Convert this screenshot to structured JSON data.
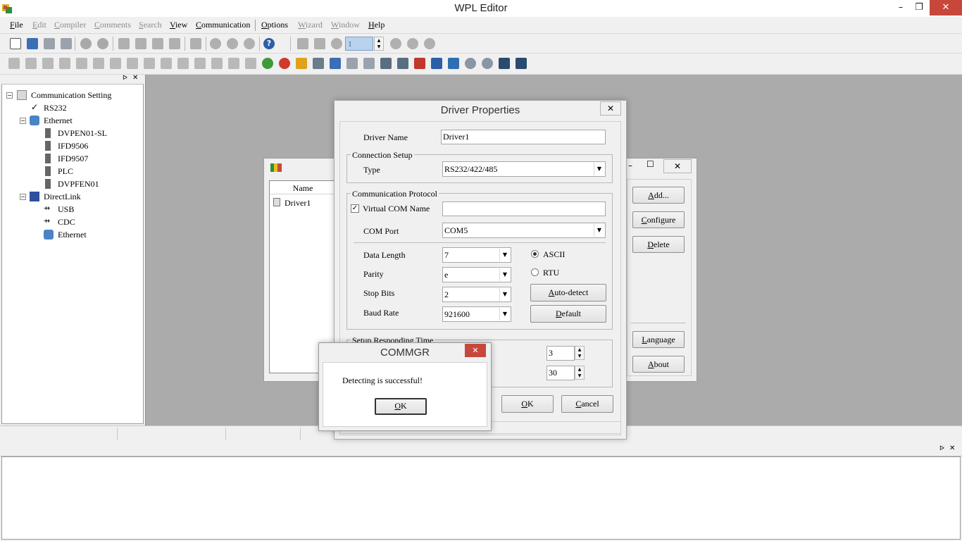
{
  "app": {
    "title": "WPL Editor"
  },
  "window_controls": {
    "minimize": "–",
    "restore": "❐",
    "close": "✕"
  },
  "menu": [
    {
      "label": "File",
      "enabled": true
    },
    {
      "label": "Edit",
      "enabled": false
    },
    {
      "label": "Compiler",
      "enabled": false
    },
    {
      "label": "Comments",
      "enabled": false
    },
    {
      "label": "Search",
      "enabled": false
    },
    {
      "label": "View",
      "enabled": true
    },
    {
      "label": "Communication",
      "enabled": true
    },
    {
      "label": "Options",
      "enabled": true
    },
    {
      "label": "Wizard",
      "enabled": false
    },
    {
      "label": "Window",
      "enabled": false
    },
    {
      "label": "Help",
      "enabled": true
    }
  ],
  "toolbar": {
    "station_value": "1",
    "help_icon": "?"
  },
  "tree": {
    "root": "Communication Setting",
    "rs232": "RS232",
    "ethernet": "Ethernet",
    "eth_items": [
      "DVPEN01-SL",
      "IFD9506",
      "IFD9507",
      "PLC",
      "DVPFEN01"
    ],
    "directlink": "DirectLink",
    "dl_items": [
      "USB",
      "CDC",
      "Ethernet"
    ],
    "check_mark": "✓"
  },
  "main_dialog": {
    "list_header": "Name",
    "drivers": [
      "Driver1"
    ],
    "buttons": {
      "add": "Add...",
      "configure": "Configure",
      "delete": "Delete",
      "language": "Language",
      "about": "About"
    },
    "min": "–",
    "max": "☐",
    "close": "✕"
  },
  "driver_props": {
    "title": "Driver Properties",
    "close": "✕",
    "driver_name_label": "Driver Name",
    "driver_name_value": "Driver1",
    "connection_setup": "Connection Setup",
    "type_label": "Type",
    "type_value": "RS232/422/485",
    "comm_protocol": "Communication Protocol",
    "virtual_com_label": "Virtual COM Name",
    "virtual_com_checked": true,
    "virtual_com_value": "",
    "com_port_label": "COM Port",
    "com_port_value": "COM5",
    "data_length_label": "Data Length",
    "data_length_value": "7",
    "parity_label": "Parity",
    "parity_value": "e",
    "stop_bits_label": "Stop Bits",
    "stop_bits_value": "2",
    "baud_rate_label": "Baud Rate",
    "baud_rate_value": "921600",
    "mode_ascii": "ASCII",
    "mode_rtu": "RTU",
    "mode_selected": "ASCII",
    "auto_detect": "Auto-detect",
    "default_btn": "Default",
    "responding_time": "Setup Responding Time",
    "spin1_value": "3",
    "spin2_value": "30",
    "ok": "OK",
    "cancel": "Cancel"
  },
  "message_box": {
    "title": "COMMGR",
    "close": "✕",
    "text": "Detecting is successful!",
    "ok": "OK"
  },
  "colors": {
    "accent_close": "#c7483b",
    "workspace": "#ababab"
  }
}
